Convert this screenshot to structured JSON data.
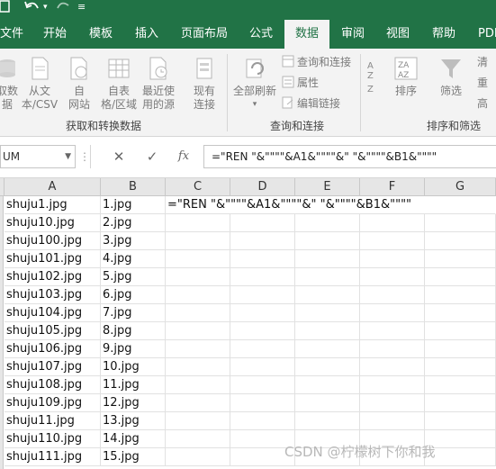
{
  "menu": {
    "tabs": [
      {
        "label": "文件"
      },
      {
        "label": "开始"
      },
      {
        "label": "模板"
      },
      {
        "label": "插入"
      },
      {
        "label": "页面布局"
      },
      {
        "label": "公式"
      },
      {
        "label": "数据"
      },
      {
        "label": "审阅"
      },
      {
        "label": "视图"
      },
      {
        "label": "帮助"
      },
      {
        "label": "PDF"
      }
    ],
    "active": "数据"
  },
  "ribbon": {
    "get_transform": {
      "label": "获取和转换数据",
      "buttons": [
        {
          "label1": "取数",
          "label2": "据",
          "icon": "database-icon"
        },
        {
          "label1": "从文",
          "label2": "本/CSV",
          "icon": "text-file-icon"
        },
        {
          "label1": "自",
          "label2": "网站",
          "icon": "web-icon"
        },
        {
          "label1": "自表",
          "label2": "格/区域",
          "icon": "table-icon"
        },
        {
          "label1": "最近使",
          "label2": "用的源",
          "icon": "recent-sources-icon"
        },
        {
          "label1": "现有",
          "label2": "连接",
          "icon": "existing-connections-icon"
        }
      ]
    },
    "queries": {
      "label": "查询和连接",
      "refresh_label": "全部刷新",
      "items": [
        "查询和连接",
        "属性",
        "编辑链接"
      ]
    },
    "sort_filter": {
      "label": "排序和筛选",
      "sort_label": "排序",
      "filter_label": "筛选",
      "side": [
        "清",
        "重",
        "高"
      ]
    }
  },
  "formula_bar": {
    "name_box": "UM",
    "cancel": "✕",
    "enter": "✓",
    "fx": "fx",
    "formula": "=\"REN \"&\"\"\"\"&A1&\"\"\"\"&\" \"&\"\"\"\"&B1&\"\"\"\""
  },
  "grid": {
    "columns": [
      "A",
      "B",
      "C",
      "D",
      "E",
      "F",
      "G"
    ],
    "col_a": [
      "shuju1.jpg",
      "shuju10.jpg",
      "shuju100.jpg",
      "shuju101.jpg",
      "shuju102.jpg",
      "shuju103.jpg",
      "shuju104.jpg",
      "shuju105.jpg",
      "shuju106.jpg",
      "shuju107.jpg",
      "shuju108.jpg",
      "shuju109.jpg",
      "shuju11.jpg",
      "shuju110.jpg",
      "shuju111.jpg"
    ],
    "col_b": [
      "1.jpg",
      "2.jpg",
      "3.jpg",
      "4.jpg",
      "5.jpg",
      "6.jpg",
      "7.jpg",
      "8.jpg",
      "9.jpg",
      "10.jpg",
      "11.jpg",
      "12.jpg",
      "13.jpg",
      "14.jpg",
      "15.jpg"
    ],
    "c1_text": "=\"REN \"&\"\"\"\"&A1&\"\"\"\"&\" \"&\"\"\"\"&B1&\"\"\"\""
  },
  "watermark": "CSDN @柠檬树下你和我",
  "colors": {
    "accent": "#217346",
    "ribbon_bg": "#f3f3f3",
    "header_bg": "#e6e6e6"
  }
}
